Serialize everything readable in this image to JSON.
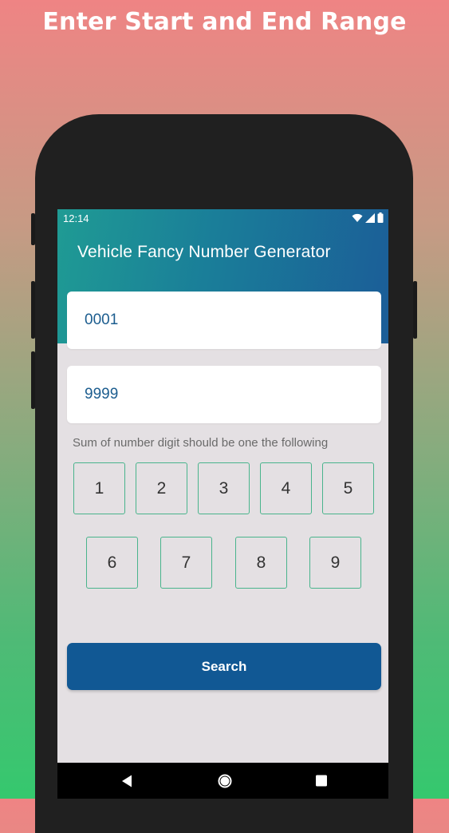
{
  "promo": {
    "headline": "Enter Start and End Range"
  },
  "status_bar": {
    "time": "12:14"
  },
  "app": {
    "title": "Vehicle Fancy Number Generator"
  },
  "form": {
    "start_value": "0001",
    "end_value": "9999",
    "hint": "Sum of number digit should be one the following",
    "digits_row1": [
      "1",
      "2",
      "3",
      "4",
      "5"
    ],
    "digits_row2": [
      "6",
      "7",
      "8",
      "9"
    ],
    "search_label": "Search"
  },
  "colors": {
    "header_gradient_start": "#1f9b94",
    "header_gradient_end": "#1b5d98",
    "accent_border": "#49b48c",
    "button": "#115894"
  },
  "icons": {
    "wifi": "wifi-icon",
    "signal": "cellular-signal-icon",
    "battery": "battery-icon",
    "back": "nav-back-icon",
    "home": "nav-home-icon",
    "recents": "nav-recents-icon"
  }
}
